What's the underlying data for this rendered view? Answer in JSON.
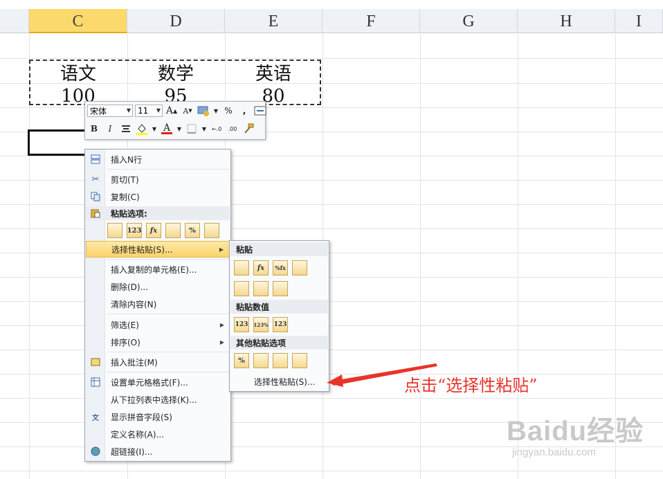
{
  "columns": [
    {
      "id": "C",
      "label": "C",
      "active": true
    },
    {
      "id": "D",
      "label": "D",
      "active": false
    },
    {
      "id": "E",
      "label": "E",
      "active": false
    },
    {
      "id": "F",
      "label": "F",
      "active": false
    },
    {
      "id": "G",
      "label": "G",
      "active": false
    },
    {
      "id": "H",
      "label": "H",
      "active": false
    },
    {
      "id": "I",
      "label": "I",
      "active": false
    }
  ],
  "cells": {
    "c_header": "语文",
    "d_header": "数学",
    "e_header": "英语",
    "c_value": "100",
    "d_value": "95",
    "e_value": "80"
  },
  "mini_toolbar": {
    "font_name": "宋体",
    "font_size": "11",
    "grow_font": "A",
    "shrink_font": "A",
    "percent": "%",
    "comma": ",",
    "bold": "B",
    "italic": "I",
    "font_color": "A"
  },
  "context_menu": {
    "insert_rows": "插入N行",
    "cut": "剪切(T)",
    "copy": "复制(C)",
    "paste_options": "粘贴选项:",
    "paste_icons": [
      "",
      "123",
      "fx",
      "",
      "%",
      ""
    ],
    "paste_special": "选择性粘贴(S)...",
    "insert_copied": "插入复制的单元格(E)...",
    "delete": "删除(D)...",
    "clear": "清除内容(N)",
    "filter": "筛选(E)",
    "sort": "排序(O)",
    "insert_comment": "插入批注(M)",
    "format_cells": "设置单元格格式(F)...",
    "pick_from_list": "从下拉列表中选择(K)...",
    "phonetic": "显示拼音字段(S)",
    "define_name": "定义名称(A)...",
    "hyperlink": "超链接(I)..."
  },
  "submenu": {
    "paste_header": "粘贴",
    "paste_values_header": "粘贴数值",
    "other_header": "其他粘贴选项",
    "paste_special_item": "选择性粘贴(S)...",
    "row1": [
      "",
      "fx",
      "%fx",
      ""
    ],
    "row3": [
      "123",
      "123%",
      "123"
    ]
  },
  "annotation": "点击“选择性粘贴”",
  "watermark": {
    "brand": "Baidu经验",
    "url": "jingyan.baidu.com"
  },
  "colors": {
    "accent_highlight": "#fbd46a",
    "annotation": "#e8332a"
  }
}
